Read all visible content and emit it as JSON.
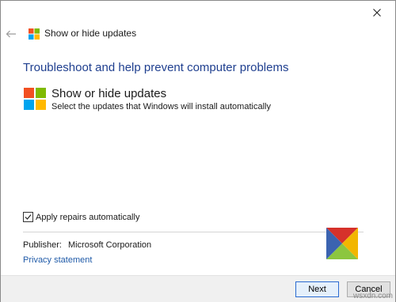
{
  "window": {
    "close_icon": "close-icon",
    "back_icon": "back-arrow-icon"
  },
  "header": {
    "app_title": "Show or hide updates",
    "app_icon": "windows-logo-icon"
  },
  "main": {
    "heading": "Troubleshoot and help prevent computer problems",
    "tool": {
      "name": "Show or hide updates",
      "description": "Select the updates that Windows will install automatically",
      "icon": "windows-logo-icon"
    },
    "apply_repairs": {
      "label": "Apply repairs automatically",
      "checked": true
    },
    "publisher": {
      "label": "Publisher:",
      "value": "Microsoft Corporation",
      "logo": "publisher-logo-icon"
    },
    "privacy_link": "Privacy statement"
  },
  "footer": {
    "next_label": "Next",
    "cancel_label": "Cancel"
  },
  "watermark": "wsxdn.com",
  "colors": {
    "heading": "#1f3f8f",
    "link": "#1f5aa8",
    "logo_red": "#f25022",
    "logo_green": "#7fba00",
    "logo_blue": "#00a4ef",
    "logo_yellow": "#ffb900"
  }
}
